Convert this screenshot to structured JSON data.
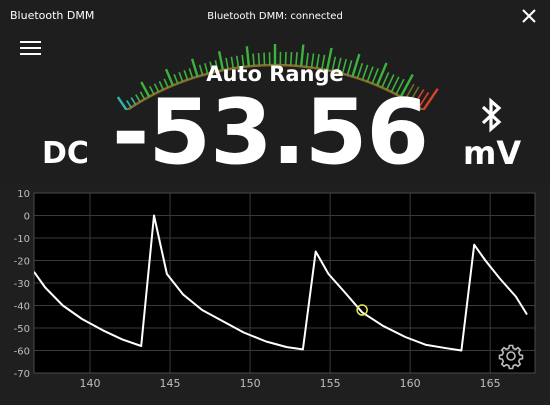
{
  "window": {
    "title": "Bluetooth DMM",
    "status": "Bluetooth DMM: connected"
  },
  "icons": {
    "close": "close-icon",
    "menu": "hamburger-menu-icon",
    "bluetooth": "bluetooth-icon",
    "settings": "gear-icon"
  },
  "meter": {
    "range_mode": "Auto Range",
    "reading": "-53.56",
    "mode": "DC",
    "unit": "mV",
    "gauge_level": 0.92
  },
  "colors": {
    "background": "#1e1e1e",
    "plot_background": "#000000",
    "trace": "#ffffff",
    "cursor": "#e6e65a",
    "gauge_low": "#2fb8a6",
    "gauge_mid": "#3db33d",
    "gauge_high": "#d9432b"
  },
  "chart_data": {
    "type": "line",
    "xlim": [
      136.5,
      167.8
    ],
    "ylim": [
      -70,
      10
    ],
    "x_ticks": [
      140,
      145,
      150,
      155,
      160,
      165
    ],
    "y_ticks": [
      10,
      0,
      -10,
      -20,
      -30,
      -40,
      -50,
      -60,
      -70
    ],
    "grid": true,
    "series": [
      {
        "x": [
          136.5,
          137.2,
          138.3,
          139.5,
          140.8,
          142.0,
          143.2,
          144.0,
          144.8,
          145.8,
          147.0,
          148.3,
          149.6,
          151.0,
          152.3,
          153.3,
          154.1,
          154.9,
          155.9,
          157.0,
          158.3,
          159.7,
          161.0,
          162.3,
          163.2,
          164.0,
          164.7,
          165.6,
          166.6,
          167.3
        ],
        "y": [
          -25,
          -32,
          -40,
          -46,
          -51,
          -55,
          -58,
          0,
          -26,
          -35,
          -42,
          -47,
          -52,
          -56,
          -58.5,
          -59.5,
          -16,
          -26,
          -34,
          -43,
          -49,
          -54,
          -57.5,
          -59,
          -60,
          -13,
          -20,
          -28,
          -36,
          -44
        ]
      }
    ],
    "cursor_point": [
      157.0,
      -42
    ]
  }
}
